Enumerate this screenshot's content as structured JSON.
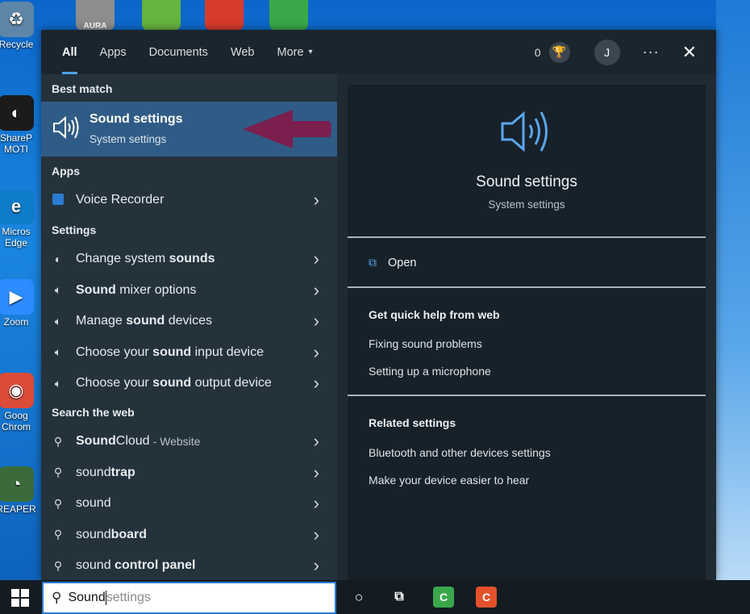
{
  "desktop": {
    "icons": [
      {
        "label": "Recycle",
        "glyph": "♻",
        "color": "#5e86a8"
      },
      {
        "label": "ShareP MOTI",
        "glyph": "◐",
        "color": "#1b1b1b"
      },
      {
        "label": "Micros Edge",
        "glyph": "e",
        "color": "#0f7cc9"
      },
      {
        "label": "Zoom",
        "glyph": "▶",
        "color": "#2d8cff"
      },
      {
        "label": "Goog Chrom",
        "glyph": "◉",
        "color": "#dd4b39"
      },
      {
        "label": "REAPER",
        "glyph": "◔",
        "color": "#3b6b3b"
      }
    ],
    "top_icons": [
      {
        "label": "AURA",
        "color": "#8e8e8e"
      },
      {
        "label": "",
        "color": "#66b33f"
      },
      {
        "label": "",
        "color": "#d73b2b"
      },
      {
        "label": "",
        "color": "#3aa84a"
      }
    ]
  },
  "search_panel": {
    "tabs": [
      {
        "label": "All",
        "active": true
      },
      {
        "label": "Apps",
        "active": false
      },
      {
        "label": "Documents",
        "active": false
      },
      {
        "label": "Web",
        "active": false
      },
      {
        "label": "More",
        "active": false,
        "caret": "▾"
      }
    ],
    "points": "0",
    "avatar_initial": "J",
    "more_label": "···",
    "close_label": "✕",
    "best_match": {
      "heading": "Best match",
      "title": "Sound settings",
      "subtitle": "System settings"
    },
    "apps": {
      "heading": "Apps",
      "items": [
        {
          "label": "Voice Recorder",
          "icon": "recorder-icon"
        }
      ]
    },
    "settings": {
      "heading": "Settings",
      "items": [
        {
          "pre": "Change system ",
          "bold": "sounds",
          "post": ""
        },
        {
          "pre": "",
          "bold": "Sound",
          "post": " mixer options"
        },
        {
          "pre": "Manage ",
          "bold": "sound",
          "post": " devices"
        },
        {
          "pre": "Choose your ",
          "bold": "sound",
          "post": " input device"
        },
        {
          "pre": "Choose your ",
          "bold": "sound",
          "post": " output device"
        }
      ]
    },
    "web": {
      "heading": "Search the web",
      "items": [
        {
          "pre": "",
          "bold": "Sound",
          "post": "Cloud",
          "suffix": "- Website"
        },
        {
          "pre": "sound",
          "bold": "trap",
          "post": "",
          "suffix": ""
        },
        {
          "pre": "sound",
          "bold": "",
          "post": "",
          "suffix": ""
        },
        {
          "pre": "sound",
          "bold": "board",
          "post": "",
          "suffix": ""
        },
        {
          "pre": "sound ",
          "bold": "control panel",
          "post": "",
          "suffix": ""
        }
      ]
    },
    "preview": {
      "title": "Sound settings",
      "subtitle": "System settings",
      "open_label": "Open",
      "help_heading": "Get quick help from web",
      "help_links": [
        "Fixing sound problems",
        "Setting up a microphone"
      ],
      "related_heading": "Related settings",
      "related_links": [
        "Bluetooth and other devices settings",
        "Make your device easier to hear"
      ]
    }
  },
  "taskbar": {
    "search_typed": "Sound",
    "search_placeholder": "settings"
  },
  "colors": {
    "accent": "#4aa3e8",
    "best_match_bg": "#2f5c86",
    "arrow": "#7a1f4e"
  }
}
